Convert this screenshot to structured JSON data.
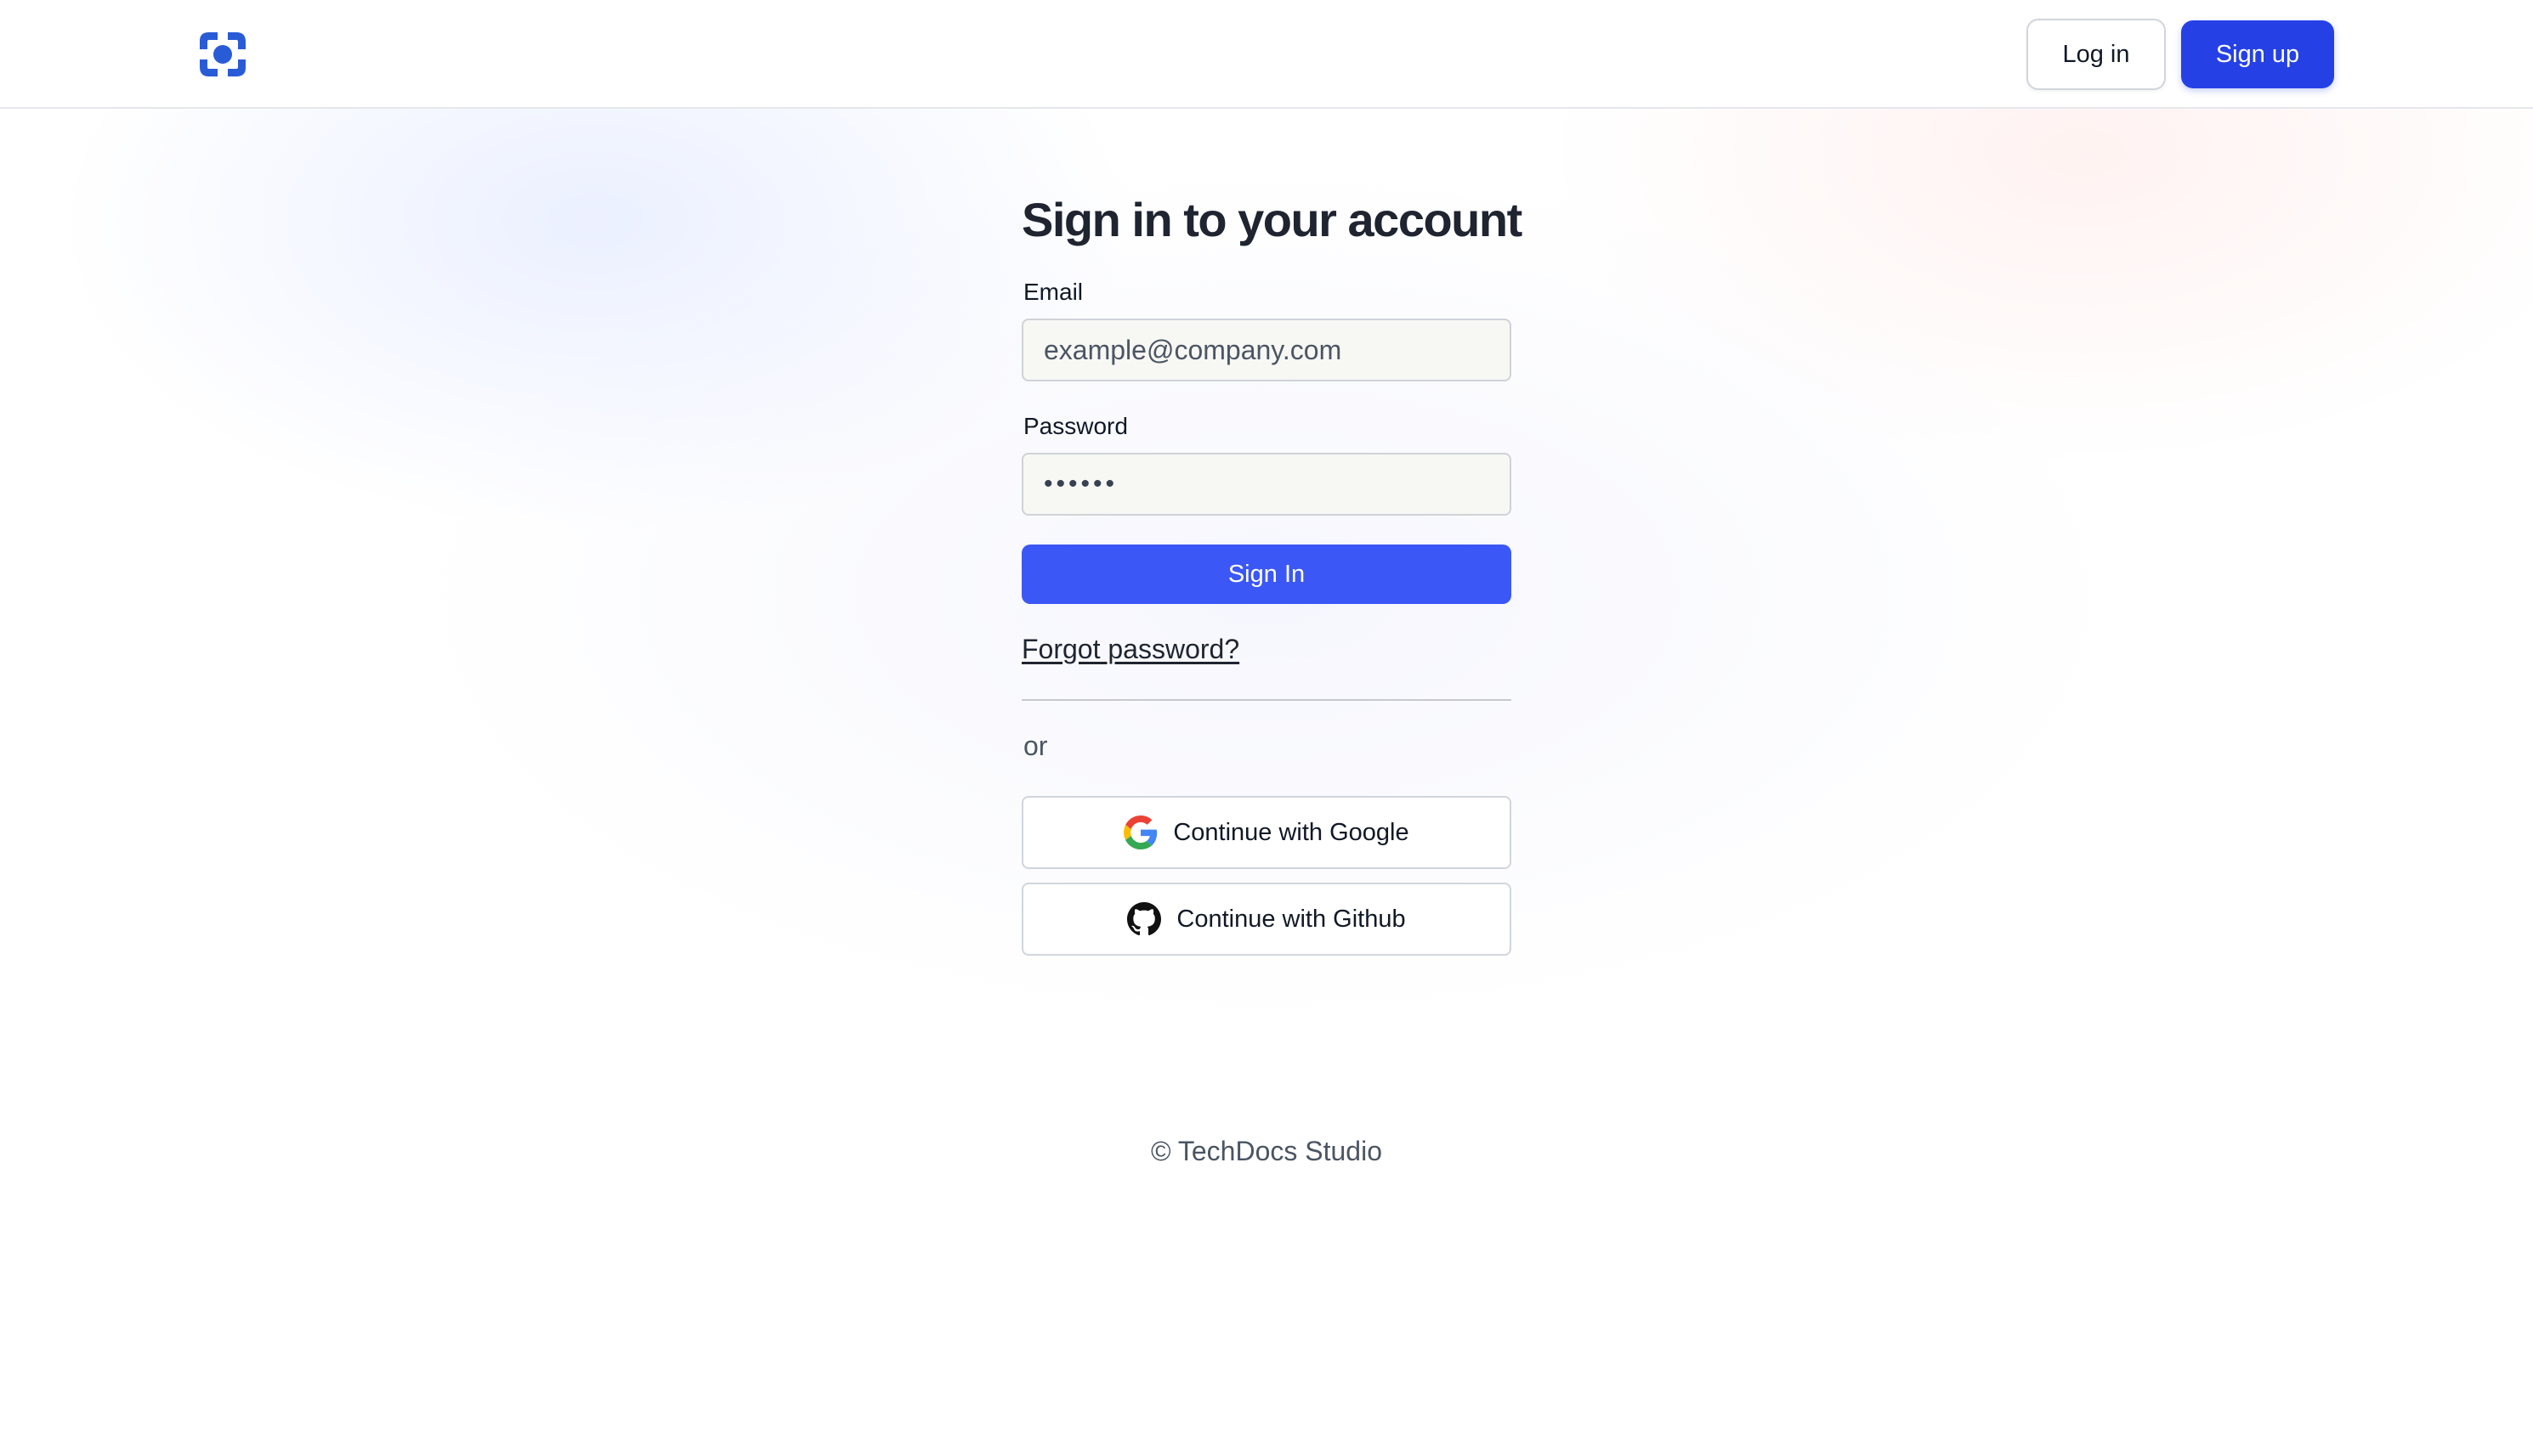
{
  "header": {
    "logo_icon": "brand-logo-icon",
    "login_label": "Log in",
    "signup_label": "Sign up"
  },
  "form": {
    "title": "Sign in to your account",
    "email": {
      "label": "Email",
      "placeholder": "example@company.com",
      "value": ""
    },
    "password": {
      "label": "Password",
      "value": "••••••"
    },
    "submit_label": "Sign In",
    "forgot_label": "Forgot password?",
    "divider_text": "or",
    "social": [
      {
        "label": "Continue with Google",
        "icon": "google-icon"
      },
      {
        "label": "Continue with Github",
        "icon": "github-icon"
      }
    ]
  },
  "footer": {
    "text": "© TechDocs Studio"
  },
  "colors": {
    "primary": "#2541e6",
    "signin_button": "#3b57f5",
    "text": "#1f2430",
    "input_bg": "#f7f7f4"
  }
}
